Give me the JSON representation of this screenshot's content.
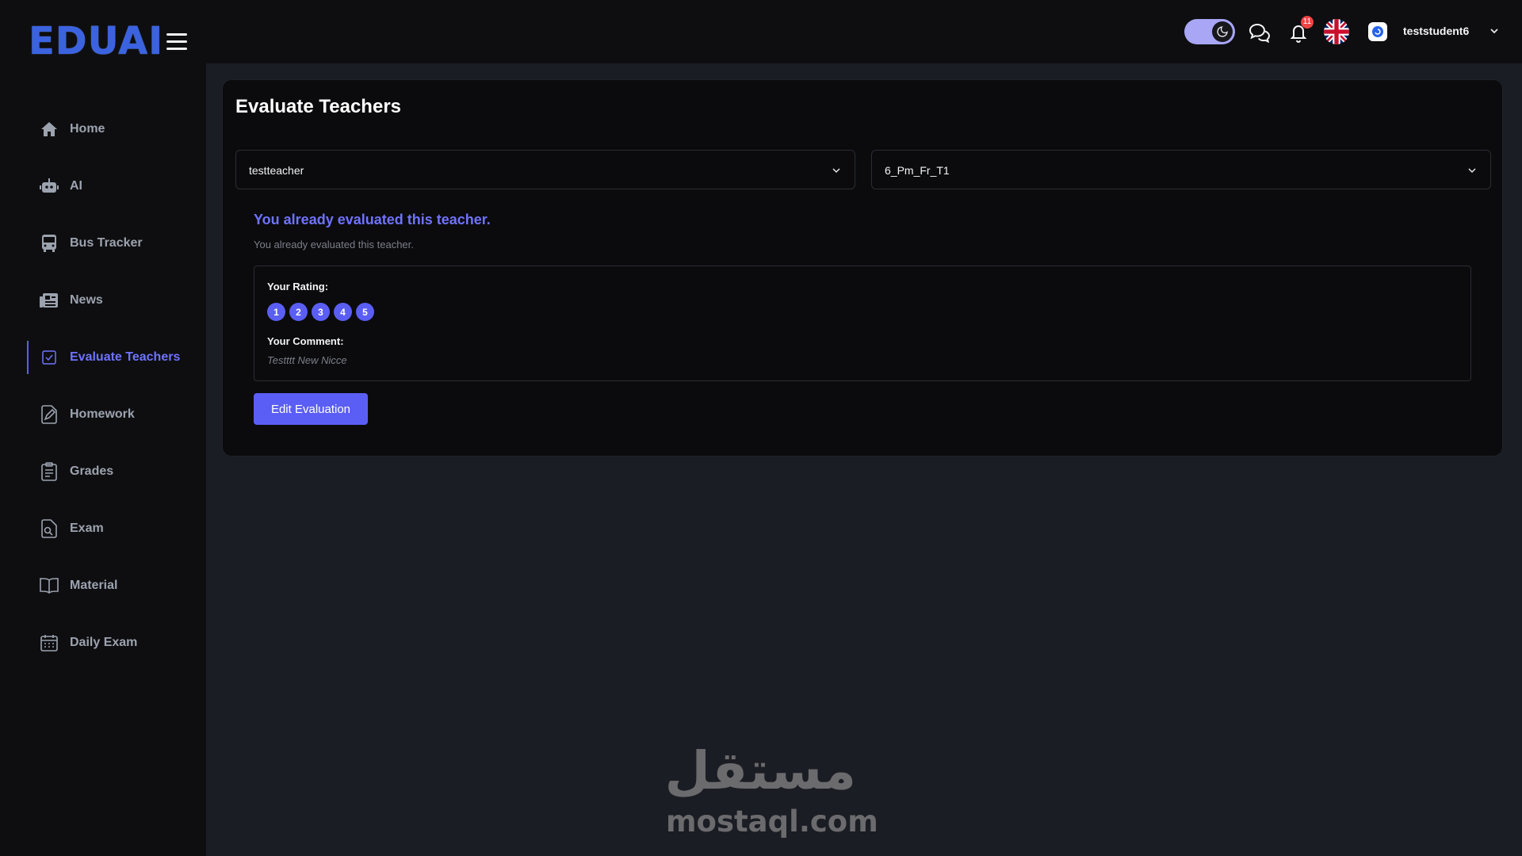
{
  "brand": {
    "logo_text": "EDUAI"
  },
  "header": {
    "notification_count": "11",
    "username": "teststudent6",
    "icons": [
      "hamburger-icon",
      "moon-icon",
      "chat-icon",
      "bell-icon",
      "uk-flag-icon",
      "avatar-icon",
      "chevron-down-icon"
    ]
  },
  "sidebar": {
    "items": [
      {
        "label": "Home",
        "icon": "home-icon"
      },
      {
        "label": "AI",
        "icon": "robot-icon"
      },
      {
        "label": "Bus Tracker",
        "icon": "bus-icon"
      },
      {
        "label": "News",
        "icon": "newspaper-icon"
      },
      {
        "label": "Evaluate Teachers",
        "icon": "checkbox-icon",
        "active": true
      },
      {
        "label": "Homework",
        "icon": "pen-document-icon"
      },
      {
        "label": "Grades",
        "icon": "clipboard-icon"
      },
      {
        "label": "Exam",
        "icon": "search-document-icon"
      },
      {
        "label": "Material",
        "icon": "book-icon"
      },
      {
        "label": "Daily Exam",
        "icon": "calendar-icon"
      }
    ]
  },
  "main": {
    "title": "Evaluate Teachers",
    "teacher_select": {
      "value": "testteacher"
    },
    "class_select": {
      "value": "6_Pm_Fr_T1"
    },
    "notice_title": "You already evaluated this teacher.",
    "notice_subtitle": "You already evaluated this teacher.",
    "evaluation": {
      "rating_label": "Your Rating:",
      "rating_value": 5,
      "rating_scale": [
        "1",
        "2",
        "3",
        "4",
        "5"
      ],
      "comment_label": "Your Comment:",
      "comment_text": "Testttt New Nicce"
    },
    "edit_button": "Edit Evaluation"
  },
  "watermark": {
    "arabic": "مستقل",
    "latin": "mostaql.com"
  },
  "colors": {
    "accent": "#5b5ef4",
    "accent_text": "#6f73ff",
    "toggle": "#a8a6f5",
    "badge": "#ef4444",
    "background": "#1b1d24",
    "panel": "#0e0e10"
  }
}
